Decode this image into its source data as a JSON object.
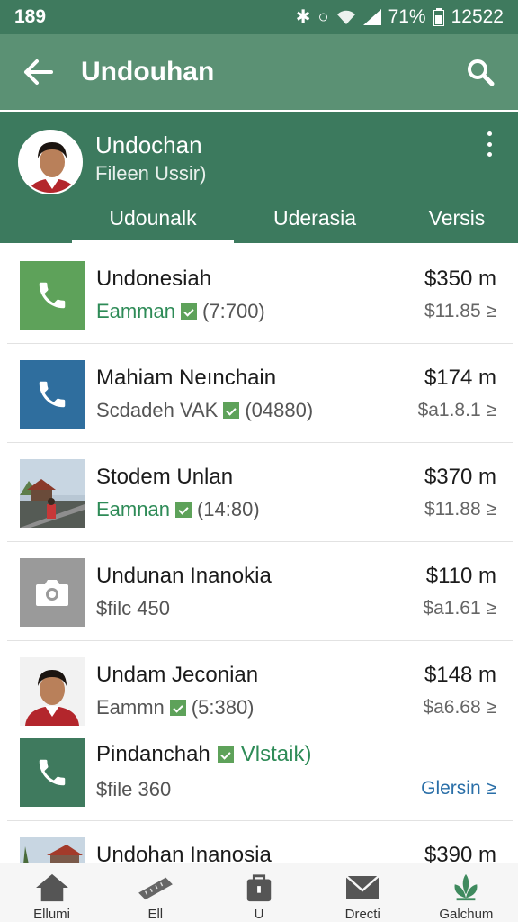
{
  "status_bar": {
    "time": "189",
    "battery": "71%",
    "clock": "12522"
  },
  "app_bar": {
    "title": "Undouhan"
  },
  "profile": {
    "name": "Undochan",
    "subtitle": "Fileen Ussir)"
  },
  "tabs": [
    {
      "label": "Udounalk",
      "active": true
    },
    {
      "label": "Uderasia",
      "active": false
    },
    {
      "label": "Versis",
      "active": false
    }
  ],
  "rows": [
    {
      "title": "Undonesiah",
      "sub_text": "Eamman",
      "sub_extra": "(7:700)",
      "amount": "$350 m",
      "amount2": "$11.85 ≥",
      "icon": "phone-icon"
    },
    {
      "title": "Mahiam Neınchain",
      "sub_text": "Scdadeh VAK",
      "sub_extra": "(04880)",
      "amount": "$174 m",
      "amount2": "$a1.8.1 ≥",
      "icon": "phone-icon"
    },
    {
      "title": "Stodem Unlan",
      "sub_text": "Eamnan",
      "sub_extra": "(14:80)",
      "amount": "$370 m",
      "amount2": "$11.88 ≥",
      "icon": "photo-thumbnail"
    },
    {
      "title": "Undunan Inanokia",
      "sub_text": "$filc 450",
      "sub_extra": "",
      "amount": "$110 m",
      "amount2": "$a1.61 ≥",
      "icon": "camera-icon"
    },
    {
      "title": "Undam Jeconian",
      "sub_text": "Eammn",
      "sub_extra": "(5:380)",
      "amount": "$148 m",
      "amount2": "$a6.68 ≥",
      "icon": "avatar"
    },
    {
      "title": "Pindanchah",
      "sub_text": "$file 360",
      "sub_extra": "Vlstaik)",
      "amount": "",
      "amount2": "Glersin ≥",
      "icon": "phone-icon"
    },
    {
      "title": "Undohan Inanosia",
      "sub_text": "",
      "sub_extra": "",
      "amount": "$390 m",
      "amount2": "",
      "icon": "photo-thumbnail"
    }
  ],
  "bottom_nav": [
    {
      "label": "Ellumi",
      "icon": "home-icon"
    },
    {
      "label": "Ell",
      "icon": "ruler-icon"
    },
    {
      "label": "U",
      "icon": "bag-icon"
    },
    {
      "label": "Drecti",
      "icon": "mail-icon"
    },
    {
      "label": "Galchum",
      "icon": "plant-icon"
    }
  ],
  "colors": {
    "primary": "#5b9174",
    "primary_dark": "#3c7a5e",
    "accent_green": "#5ea25a",
    "blue": "#2f6e9e",
    "link": "#2a6fa8"
  }
}
